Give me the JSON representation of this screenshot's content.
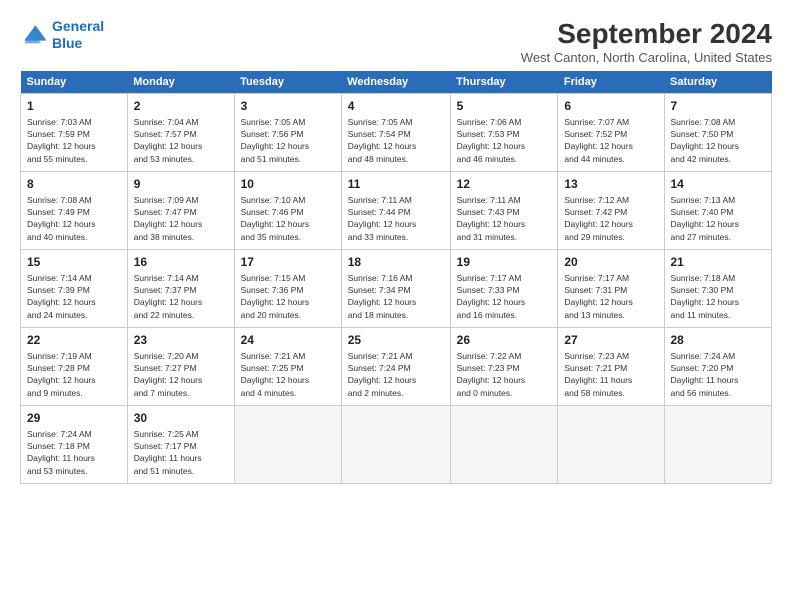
{
  "logo": {
    "line1": "General",
    "line2": "Blue"
  },
  "title": "September 2024",
  "location": "West Canton, North Carolina, United States",
  "weekdays": [
    "Sunday",
    "Monday",
    "Tuesday",
    "Wednesday",
    "Thursday",
    "Friday",
    "Saturday"
  ],
  "weeks": [
    [
      {
        "day": "1",
        "info": "Sunrise: 7:03 AM\nSunset: 7:59 PM\nDaylight: 12 hours\nand 55 minutes."
      },
      {
        "day": "2",
        "info": "Sunrise: 7:04 AM\nSunset: 7:57 PM\nDaylight: 12 hours\nand 53 minutes."
      },
      {
        "day": "3",
        "info": "Sunrise: 7:05 AM\nSunset: 7:56 PM\nDaylight: 12 hours\nand 51 minutes."
      },
      {
        "day": "4",
        "info": "Sunrise: 7:05 AM\nSunset: 7:54 PM\nDaylight: 12 hours\nand 48 minutes."
      },
      {
        "day": "5",
        "info": "Sunrise: 7:06 AM\nSunset: 7:53 PM\nDaylight: 12 hours\nand 46 minutes."
      },
      {
        "day": "6",
        "info": "Sunrise: 7:07 AM\nSunset: 7:52 PM\nDaylight: 12 hours\nand 44 minutes."
      },
      {
        "day": "7",
        "info": "Sunrise: 7:08 AM\nSunset: 7:50 PM\nDaylight: 12 hours\nand 42 minutes."
      }
    ],
    [
      {
        "day": "8",
        "info": "Sunrise: 7:08 AM\nSunset: 7:49 PM\nDaylight: 12 hours\nand 40 minutes."
      },
      {
        "day": "9",
        "info": "Sunrise: 7:09 AM\nSunset: 7:47 PM\nDaylight: 12 hours\nand 38 minutes."
      },
      {
        "day": "10",
        "info": "Sunrise: 7:10 AM\nSunset: 7:46 PM\nDaylight: 12 hours\nand 35 minutes."
      },
      {
        "day": "11",
        "info": "Sunrise: 7:11 AM\nSunset: 7:44 PM\nDaylight: 12 hours\nand 33 minutes."
      },
      {
        "day": "12",
        "info": "Sunrise: 7:11 AM\nSunset: 7:43 PM\nDaylight: 12 hours\nand 31 minutes."
      },
      {
        "day": "13",
        "info": "Sunrise: 7:12 AM\nSunset: 7:42 PM\nDaylight: 12 hours\nand 29 minutes."
      },
      {
        "day": "14",
        "info": "Sunrise: 7:13 AM\nSunset: 7:40 PM\nDaylight: 12 hours\nand 27 minutes."
      }
    ],
    [
      {
        "day": "15",
        "info": "Sunrise: 7:14 AM\nSunset: 7:39 PM\nDaylight: 12 hours\nand 24 minutes."
      },
      {
        "day": "16",
        "info": "Sunrise: 7:14 AM\nSunset: 7:37 PM\nDaylight: 12 hours\nand 22 minutes."
      },
      {
        "day": "17",
        "info": "Sunrise: 7:15 AM\nSunset: 7:36 PM\nDaylight: 12 hours\nand 20 minutes."
      },
      {
        "day": "18",
        "info": "Sunrise: 7:16 AM\nSunset: 7:34 PM\nDaylight: 12 hours\nand 18 minutes."
      },
      {
        "day": "19",
        "info": "Sunrise: 7:17 AM\nSunset: 7:33 PM\nDaylight: 12 hours\nand 16 minutes."
      },
      {
        "day": "20",
        "info": "Sunrise: 7:17 AM\nSunset: 7:31 PM\nDaylight: 12 hours\nand 13 minutes."
      },
      {
        "day": "21",
        "info": "Sunrise: 7:18 AM\nSunset: 7:30 PM\nDaylight: 12 hours\nand 11 minutes."
      }
    ],
    [
      {
        "day": "22",
        "info": "Sunrise: 7:19 AM\nSunset: 7:28 PM\nDaylight: 12 hours\nand 9 minutes."
      },
      {
        "day": "23",
        "info": "Sunrise: 7:20 AM\nSunset: 7:27 PM\nDaylight: 12 hours\nand 7 minutes."
      },
      {
        "day": "24",
        "info": "Sunrise: 7:21 AM\nSunset: 7:25 PM\nDaylight: 12 hours\nand 4 minutes."
      },
      {
        "day": "25",
        "info": "Sunrise: 7:21 AM\nSunset: 7:24 PM\nDaylight: 12 hours\nand 2 minutes."
      },
      {
        "day": "26",
        "info": "Sunrise: 7:22 AM\nSunset: 7:23 PM\nDaylight: 12 hours\nand 0 minutes."
      },
      {
        "day": "27",
        "info": "Sunrise: 7:23 AM\nSunset: 7:21 PM\nDaylight: 11 hours\nand 58 minutes."
      },
      {
        "day": "28",
        "info": "Sunrise: 7:24 AM\nSunset: 7:20 PM\nDaylight: 11 hours\nand 56 minutes."
      }
    ],
    [
      {
        "day": "29",
        "info": "Sunrise: 7:24 AM\nSunset: 7:18 PM\nDaylight: 11 hours\nand 53 minutes."
      },
      {
        "day": "30",
        "info": "Sunrise: 7:25 AM\nSunset: 7:17 PM\nDaylight: 11 hours\nand 51 minutes."
      },
      {
        "day": "",
        "info": ""
      },
      {
        "day": "",
        "info": ""
      },
      {
        "day": "",
        "info": ""
      },
      {
        "day": "",
        "info": ""
      },
      {
        "day": "",
        "info": ""
      }
    ]
  ]
}
